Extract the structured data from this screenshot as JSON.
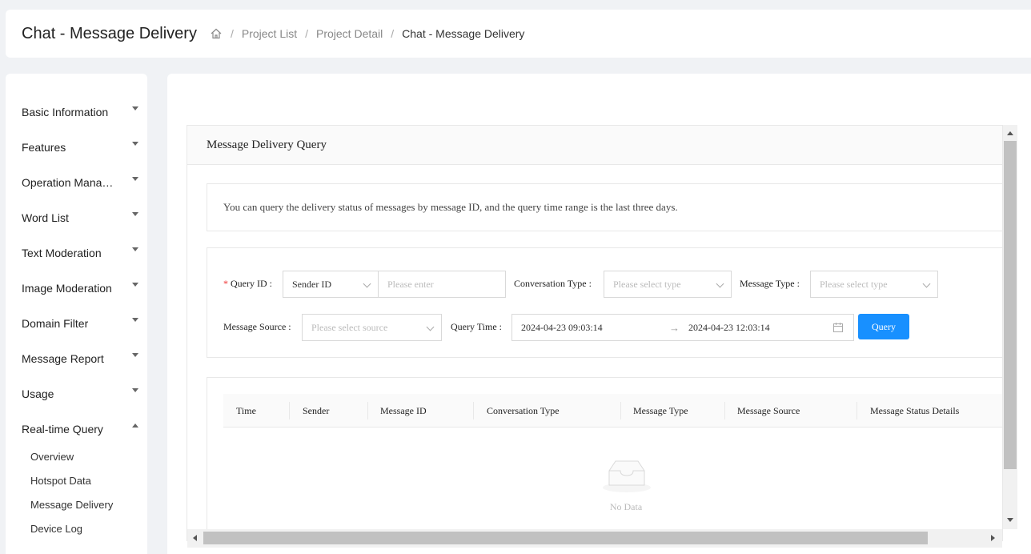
{
  "header": {
    "title": "Chat - Message Delivery",
    "breadcrumb": [
      "Project List",
      "Project Detail",
      "Chat - Message Delivery"
    ]
  },
  "sidebar": {
    "items": [
      {
        "label": "Basic Information"
      },
      {
        "label": "Features"
      },
      {
        "label": "Operation Management"
      },
      {
        "label": "Word List"
      },
      {
        "label": "Text Moderation"
      },
      {
        "label": "Image Moderation"
      },
      {
        "label": "Domain Filter"
      },
      {
        "label": "Message Report"
      },
      {
        "label": "Usage"
      },
      {
        "label": "Real-time Query"
      }
    ],
    "subitems": [
      "Overview",
      "Hotspot Data",
      "Message Delivery",
      "Device Log"
    ]
  },
  "panel": {
    "title": "Message Delivery Query",
    "note": "You can query the delivery status of messages by message ID, and the query time range is the last three days."
  },
  "form": {
    "query_id_label": "Query ID :",
    "query_id_type": "Sender ID",
    "query_id_placeholder": "Please enter",
    "conv_type_label": "Conversation Type :",
    "conv_type_placeholder": "Please select type",
    "msg_type_label": "Message Type :",
    "msg_type_placeholder": "Please select type",
    "msg_source_label": "Message Source :",
    "msg_source_placeholder": "Please select source",
    "query_time_label": "Query Time :",
    "time_start": "2024-04-23 09:03:14",
    "time_end": "2024-04-23 12:03:14",
    "query_button": "Query"
  },
  "table": {
    "columns": [
      "Time",
      "Sender",
      "Message ID",
      "Conversation Type",
      "Message Type",
      "Message Source",
      "Message Status Details"
    ],
    "empty_text": "No Data"
  },
  "colors": {
    "accent": "#1890ff",
    "required": "#ee3333"
  }
}
